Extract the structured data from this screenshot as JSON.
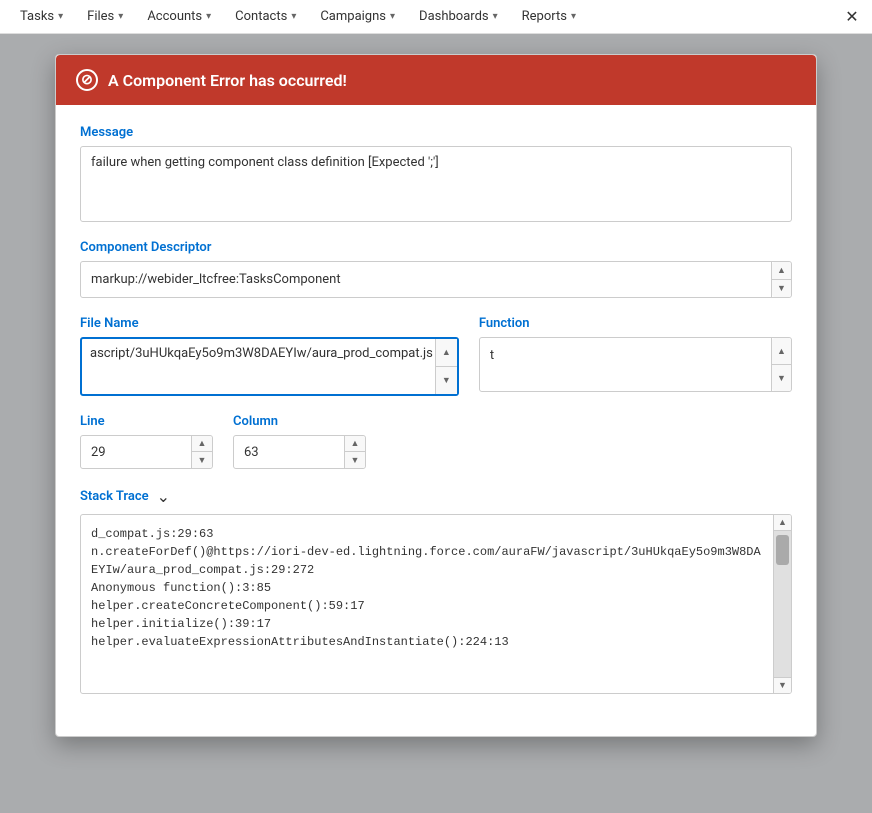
{
  "nav": {
    "items": [
      {
        "label": "Tasks",
        "id": "tasks"
      },
      {
        "label": "Files",
        "id": "files"
      },
      {
        "label": "Accounts",
        "id": "accounts"
      },
      {
        "label": "Contacts",
        "id": "contacts"
      },
      {
        "label": "Campaigns",
        "id": "campaigns"
      },
      {
        "label": "Dashboards",
        "id": "dashboards"
      },
      {
        "label": "Reports",
        "id": "reports"
      }
    ]
  },
  "modal": {
    "title": "A Component Error has occurred!",
    "fields": {
      "message_label": "Message",
      "message_value": "failure when getting component class definition [Expected ';']",
      "component_descriptor_label": "Component Descriptor",
      "component_descriptor_value": "markup://webider_ltcfree:TasksComponent",
      "file_name_label": "File Name",
      "file_name_value": "ascript/3uHUkqaEy5o9m3W8DAEYIw/aura_prod_compat.js",
      "function_label": "Function",
      "function_value": "t",
      "line_label": "Line",
      "line_value": "29",
      "column_label": "Column",
      "column_value": "63",
      "stack_trace_label": "Stack Trace",
      "stack_trace_content": "d_compat.js:29:63\nn.createForDef()@https://iori-dev-ed.lightning.force.com/auraFW/javascript/3uHUkqaEy5o9m3W8DAEYIw/aura_prod_compat.js:29:272\nAnonymous function():3:85\nhelper.createConcreteComponent():59:17\nhelper.initialize():39:17\nhelper.evaluateExpressionAttributesAndInstantiate():224:13"
    }
  }
}
